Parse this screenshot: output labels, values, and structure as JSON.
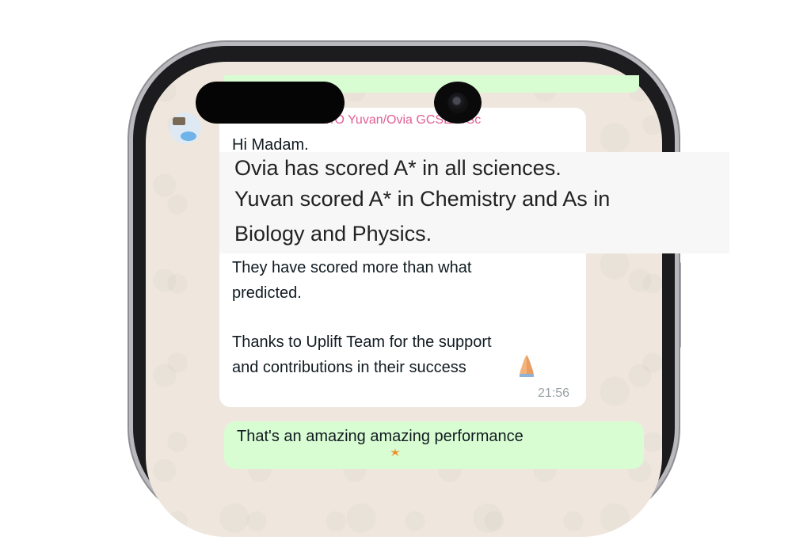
{
  "chat": {
    "sender": "Pr Umashanker T/O Yuvan/Ovia GCSE/9/Sc",
    "greeting": "Hi Madam.",
    "highlight_lines": [
      "Ovia has scored A* in all sciences.",
      "Yuvan  scored A* in Chemistry and As in",
      "Biology and Physics."
    ],
    "body_lines": [
      "They have scored more than what",
      "predicted.",
      "Thanks to Uplift Team for the support",
      "and contributions in their success"
    ],
    "time": "21:56",
    "reply": "That's an amazing amazing performance"
  },
  "icons": {
    "avatar": "sender-avatar",
    "emoji": "folded-hands-icon",
    "reply_emoji": "sparkle-icon"
  },
  "colors": {
    "sender_name": "#e35d96",
    "outgoing_bubble": "#d9fdd3",
    "incoming_bubble": "#ffffff",
    "chat_bg": "#efe7dd"
  }
}
